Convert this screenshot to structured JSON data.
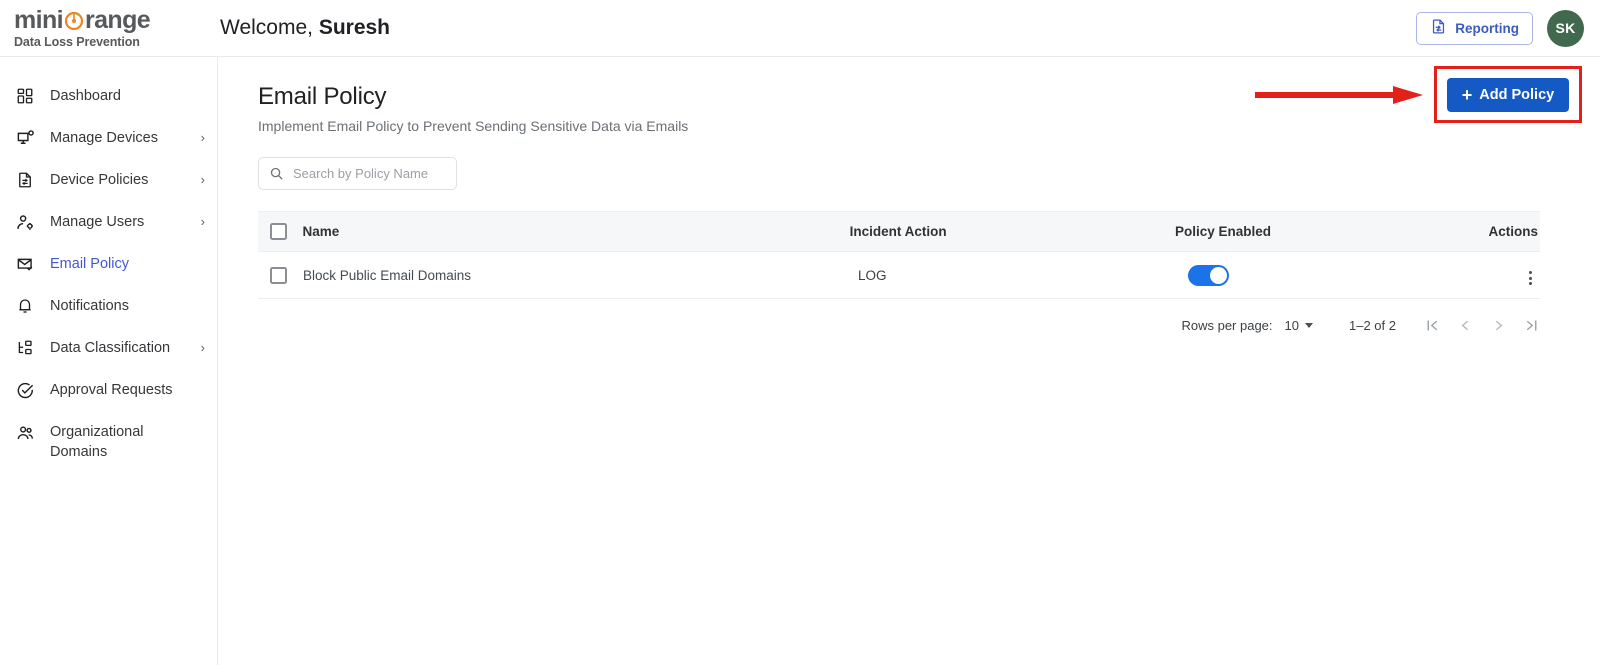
{
  "header": {
    "logo_word_pre": "mini",
    "logo_word_post": "range",
    "logo_icon": "orange-fruit-icon",
    "logo_subtitle": "Data Loss Prevention",
    "welcome_prefix": "Welcome, ",
    "welcome_user": "Suresh",
    "reporting_label": "Reporting",
    "reporting_icon": "report-document-icon",
    "avatar_initials": "SK",
    "avatar_color": "#40694f"
  },
  "sidebar": {
    "items": [
      {
        "label": "Dashboard",
        "icon": "grid-dashboard-icon",
        "chevron": false,
        "active": false,
        "two_line": false
      },
      {
        "label": "Manage Devices",
        "icon": "monitor-device-icon",
        "chevron": true,
        "active": false,
        "two_line": false
      },
      {
        "label": "Device Policies",
        "icon": "document-policy-icon",
        "chevron": true,
        "active": false,
        "two_line": false
      },
      {
        "label": "Manage Users",
        "icon": "user-settings-icon",
        "chevron": true,
        "active": false,
        "two_line": false
      },
      {
        "label": "Email Policy",
        "icon": "envelope-check-icon",
        "chevron": false,
        "active": true,
        "two_line": false
      },
      {
        "label": "Notifications",
        "icon": "bell-icon",
        "chevron": false,
        "active": false,
        "two_line": false
      },
      {
        "label": "Data Classification",
        "icon": "hierarchy-icon",
        "chevron": true,
        "active": false,
        "two_line": false
      },
      {
        "label": "Approval Requests",
        "icon": "check-circle-icon",
        "chevron": false,
        "active": false,
        "two_line": false
      },
      {
        "label": "Organizational\nDomains",
        "icon": "people-group-icon",
        "chevron": false,
        "active": false,
        "two_line": true
      }
    ],
    "active_color": "#4258d0"
  },
  "main": {
    "title": "Email Policy",
    "subtitle": "Implement Email Policy to Prevent Sending Sensitive Data via Emails",
    "add_button": {
      "label": "Add Policy",
      "plus": "+",
      "color": "#1459c4"
    },
    "annotation": {
      "type": "red-highlight-box-and-arrow",
      "color": "#e32119"
    },
    "search": {
      "placeholder": "Search by Policy Name",
      "value": "",
      "icon": "search-icon"
    },
    "table": {
      "columns": [
        "Name",
        "Incident Action",
        "Policy Enabled",
        "Actions"
      ],
      "rows": [
        {
          "selected": false,
          "name": "Block Public Email Domains",
          "incident_action": "LOG",
          "policy_enabled": true,
          "actions_icon": "kebab-menu-icon"
        }
      ]
    },
    "pagination": {
      "rows_per_page_label": "Rows per page:",
      "rows_per_page_value": "10",
      "range_label": "1–2 of 2",
      "first_icon": "first-page-icon",
      "prev_icon": "previous-page-icon",
      "next_icon": "next-page-icon",
      "last_icon": "last-page-icon"
    }
  }
}
